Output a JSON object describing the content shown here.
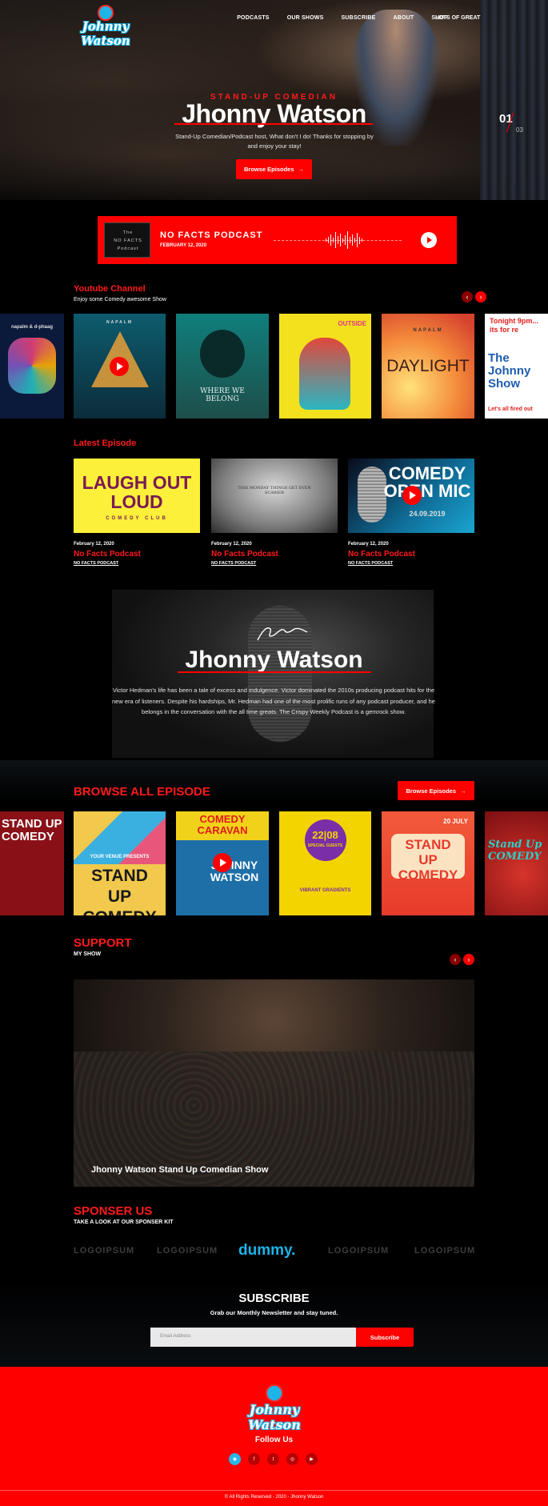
{
  "brand": {
    "logo_text": "Johnny Watson"
  },
  "nav": {
    "items": [
      "PODCASTS",
      "OUR SHOWS",
      "SUBSCRIBE",
      "ABOUT",
      "SHOP"
    ],
    "last": "LOTS OF GREAT"
  },
  "hero": {
    "eyebrow": "STAND-UP COMEDIAN",
    "title": "Jhonny Watson",
    "subtitle": "Stand-Up Comedian/Podcast host, What don't I do! Thanks for stopping by and enjoy your stay!",
    "button": "Browse Episodes",
    "slide_current": "01",
    "slide_total": "03"
  },
  "podcast_bar": {
    "thumb_lines": [
      "The",
      "NO FACTS",
      "Podcast"
    ],
    "title": "NO FACTS PODCAST",
    "date": "FEBRUARY 12, 2020"
  },
  "youtube": {
    "title": "Youtube Channel",
    "subtitle": "Enjoy some Comedy awesome Show",
    "posters": [
      {
        "text": "napalm & d-phaag"
      },
      {
        "text": "NAPALM"
      },
      {
        "text": "WHERE WE BELONG"
      },
      {
        "text": "OUTSIDE"
      },
      {
        "text": "DAYLIGHT",
        "top": "NAPALM"
      },
      {
        "text": "The Johnny Show",
        "top": "Tonight 9pm... its for re",
        "bottom": "Let's all fired out"
      }
    ]
  },
  "latest": {
    "title": "Latest Episode",
    "episodes": [
      {
        "date": "February 12, 2020",
        "title": "No Facts Podcast",
        "link": "NO FACTS PODCAST",
        "poster_main": "LAUGH OUT LOUD",
        "poster_sub": "COMEDY CLUB"
      },
      {
        "date": "February 12, 2020",
        "title": "No Facts Podcast",
        "link": "NO FACTS PODCAST",
        "poster_main": "THIS MONDAY THINGS GET EVEN SCARIER"
      },
      {
        "date": "February 12, 2020",
        "title": "No Facts Podcast",
        "link": "NO FACTS PODCAST",
        "poster_main": "COMEDY OPEN MIC",
        "poster_sub": "24.09.2019"
      }
    ]
  },
  "about": {
    "title": "Jhonny Watson",
    "text": "Victor Hedman's life has been a tale of excess and indulgence. Victor dominated the 2010s producing podcast hits for the new era of listeners. Despite his hardships, Mr. Hedman had one of the most prolific runs of any podcast producer, and he belongs in the conversation with the all time greats. The Crispy Weekly Podcast is a gemrock show."
  },
  "browse": {
    "title": "BROWSE ALL EPISODE",
    "button": "Browse Episodes",
    "posters": [
      {
        "text": "STAND UP COMEDY"
      },
      {
        "text": "STAND UP COMEDY",
        "top": "YOUR VENUE PRESENTS"
      },
      {
        "text": "COMEDY CARAVAN",
        "sub": "JOHNNY WATSON"
      },
      {
        "text": "22|08",
        "sub": "SPECIAL GUESTS",
        "bottom": "VIBRANT GRADIENTS"
      },
      {
        "text": "STAND UP COMEDY",
        "top": "20 JULY"
      },
      {
        "text": "Stand Up COMEDY"
      }
    ]
  },
  "support": {
    "title": "SUPPORT",
    "subtitle": "MY SHOW",
    "caption": "Jhonny Watson Stand Up Comedian Show"
  },
  "sponsor": {
    "title": "SPONSER US",
    "subtitle": "TAKE A LOOK AT OUR SPONSER KIT",
    "logos": [
      "LOGOIPSUM",
      "LOGOIPSUM",
      "dummy.",
      "LOGOIPSUM",
      "LOGOIPSUM"
    ]
  },
  "subscribe": {
    "title": "SUBSCRIBE",
    "subtitle": "Grab our Monthly Newsletter and stay tuned.",
    "placeholder": "Email Address",
    "button": "Subscribe"
  },
  "footer": {
    "follow": "Follow Us",
    "socials": [
      "rss-icon",
      "facebook-icon",
      "twitter-icon",
      "instagram-icon",
      "youtube-icon"
    ],
    "copyright": "© All Rights Reserved - 2020 - Jhonny Watson"
  },
  "colors": {
    "accent": "#ff0000",
    "brand_blue": "#29b7ea",
    "background": "#000000"
  }
}
